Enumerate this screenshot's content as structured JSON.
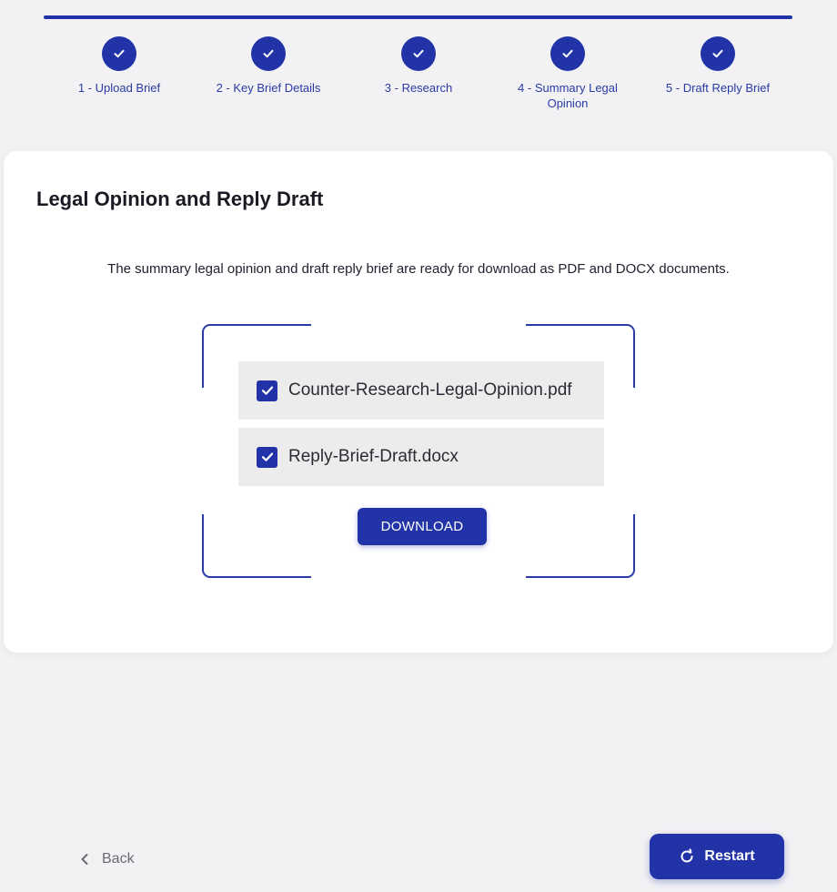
{
  "stepper": {
    "steps": [
      {
        "label": "1 - Upload Brief",
        "status": "completed",
        "icon": "check-icon"
      },
      {
        "label": "2 - Key Brief Details",
        "status": "completed",
        "icon": "check-icon"
      },
      {
        "label": "3 - Research",
        "status": "completed",
        "icon": "check-icon"
      },
      {
        "label": "4 - Summary Legal Opinion",
        "status": "completed",
        "icon": "check-icon"
      },
      {
        "label": "5 - Draft Reply Brief",
        "status": "completed",
        "icon": "check-icon"
      }
    ]
  },
  "card": {
    "title": "Legal Opinion and Reply Draft",
    "description": "The summary legal opinion and draft reply brief are ready for download as PDF and DOCX documents."
  },
  "files": [
    {
      "name": "Counter-Research-Legal-Opinion.pdf",
      "checked": true
    },
    {
      "name": "Reply-Brief-Draft.docx",
      "checked": true
    }
  ],
  "actions": {
    "download_label": "DOWNLOAD",
    "back_label": "Back",
    "back_icon": "chevron-left-icon",
    "restart_label": "Restart",
    "restart_icon": "refresh-icon"
  },
  "colors": {
    "accent": "#2233a8",
    "background": "#f2f2f4",
    "card": "#ffffff",
    "file_row": "#ececec",
    "muted_text": "#6b6b78"
  }
}
